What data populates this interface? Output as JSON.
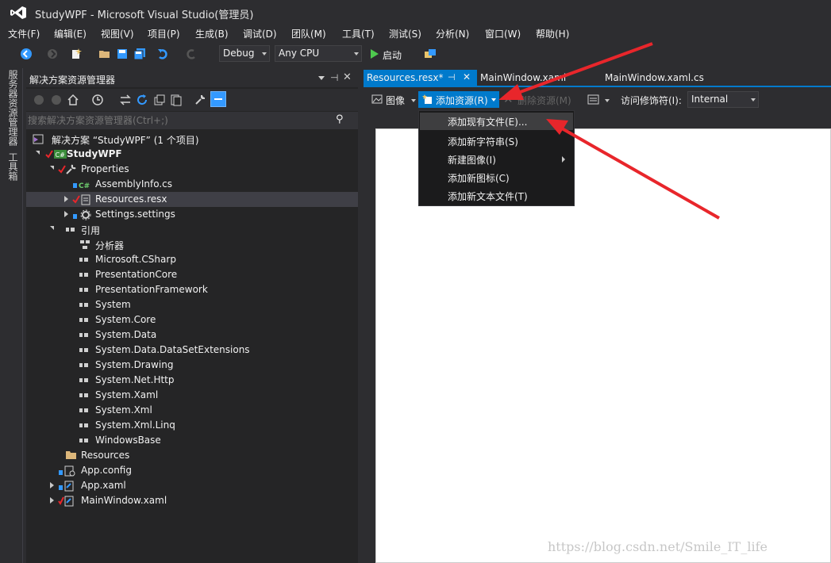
{
  "window": {
    "title": "StudyWPF - Microsoft Visual Studio(管理员)"
  },
  "menu": [
    "文件(F)",
    "编辑(E)",
    "视图(V)",
    "项目(P)",
    "生成(B)",
    "调试(D)",
    "团队(M)",
    "工具(T)",
    "测试(S)",
    "分析(N)",
    "窗口(W)",
    "帮助(H)"
  ],
  "toolbar": {
    "config": "Debug",
    "platform": "Any CPU",
    "start_label": "启动"
  },
  "side_tabs": [
    "服务器资源管理器",
    "工具箱"
  ],
  "solution_explorer": {
    "title": "解决方案资源管理器",
    "search_placeholder": "搜索解决方案资源管理器(Ctrl+;)",
    "tree": [
      "解决方案 “StudyWPF” (1 个项目)",
      "StudyWPF",
      "Properties",
      "AssemblyInfo.cs",
      "Resources.resx",
      "Settings.settings",
      "引用",
      "分析器",
      "Microsoft.CSharp",
      "PresentationCore",
      "PresentationFramework",
      "System",
      "System.Core",
      "System.Data",
      "System.Data.DataSetExtensions",
      "System.Drawing",
      "System.Net.Http",
      "System.Xaml",
      "System.Xml",
      "System.Xml.Linq",
      "WindowsBase",
      "Resources",
      "App.config",
      "App.xaml",
      "MainWindow.xaml"
    ]
  },
  "doc_tabs": [
    "Resources.resx*",
    "MainWindow.xaml",
    "MainWindow.xaml.cs"
  ],
  "resource_toolbar": {
    "image_label": "图像",
    "add_resource": "添加资源(R)",
    "remove_resource": "删除资源(M)",
    "access_modifier_label": "访问修饰符(I):",
    "access_modifier_value": "Internal"
  },
  "dropdown": [
    "添加现有文件(E)...",
    "添加新字符串(S)",
    "新建图像(I)",
    "添加新图标(C)",
    "添加新文本文件(T)"
  ],
  "watermark": "https://blog.csdn.net/Smile_IT_life",
  "colors": {
    "accent": "#007acc",
    "annotation_arrow": "#e8262b",
    "background": "#2d2d30"
  }
}
